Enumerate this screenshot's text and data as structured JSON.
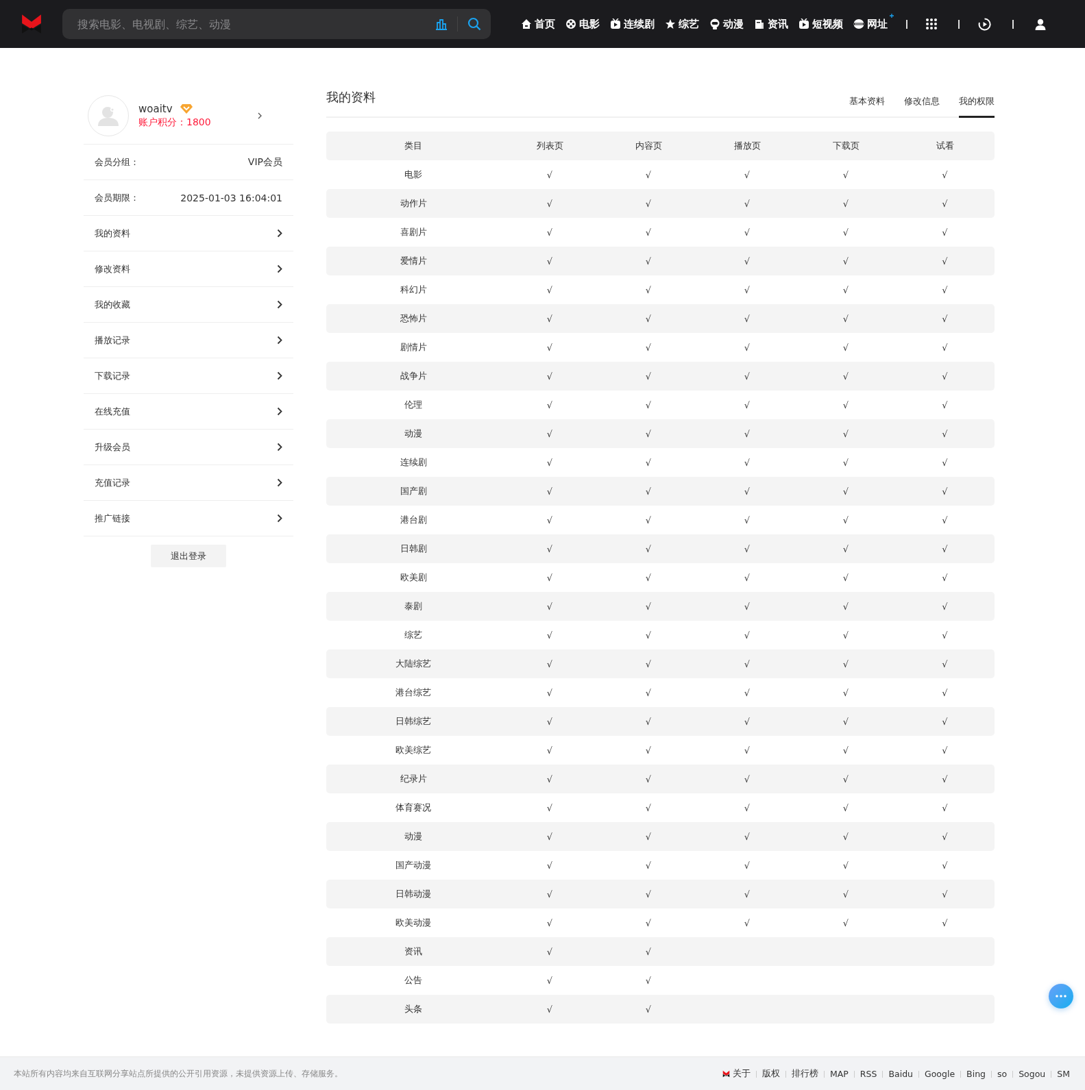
{
  "header": {
    "search": {
      "placeholder": "搜索电影、电视剧、综艺、动漫"
    },
    "nav": [
      {
        "label": "首页",
        "kind": "home"
      },
      {
        "label": "电影",
        "kind": "film"
      },
      {
        "label": "连续剧",
        "kind": "tv"
      },
      {
        "label": "综艺",
        "kind": "star"
      },
      {
        "label": "动漫",
        "kind": "face"
      },
      {
        "label": "资讯",
        "kind": "doc"
      },
      {
        "label": "短视频",
        "kind": "tv"
      },
      {
        "label": "网址",
        "kind": "globe"
      }
    ]
  },
  "sidebar": {
    "user": {
      "name": "woaitv",
      "points": "账户积分：1800"
    },
    "info": [
      {
        "label": "会员分组：",
        "value": "VIP会员"
      },
      {
        "label": "会员期限：",
        "value": "2025-01-03 16:04:01"
      }
    ],
    "menu": [
      "我的资料",
      "修改资料",
      "我的收藏",
      "播放记录",
      "下载记录",
      "在线充值",
      "升级会员",
      "充值记录",
      "推广链接"
    ],
    "logout": "退出登录"
  },
  "main": {
    "title": "我的资料",
    "tabs": [
      {
        "label": "基本资料",
        "selected": false
      },
      {
        "label": "修改信息",
        "selected": false
      },
      {
        "label": "我的权限",
        "selected": true
      }
    ],
    "table": {
      "columns": [
        "类目",
        "列表页",
        "内容页",
        "播放页",
        "下载页",
        "试看"
      ],
      "rows": [
        {
          "cells": [
            "电影",
            "√",
            "√",
            "√",
            "√",
            "√"
          ]
        },
        {
          "cells": [
            "动作片",
            "√",
            "√",
            "√",
            "√",
            "√"
          ]
        },
        {
          "cells": [
            "喜剧片",
            "√",
            "√",
            "√",
            "√",
            "√"
          ]
        },
        {
          "cells": [
            "爱情片",
            "√",
            "√",
            "√",
            "√",
            "√"
          ]
        },
        {
          "cells": [
            "科幻片",
            "√",
            "√",
            "√",
            "√",
            "√"
          ]
        },
        {
          "cells": [
            "恐怖片",
            "√",
            "√",
            "√",
            "√",
            "√"
          ]
        },
        {
          "cells": [
            "剧情片",
            "√",
            "√",
            "√",
            "√",
            "√"
          ]
        },
        {
          "cells": [
            "战争片",
            "√",
            "√",
            "√",
            "√",
            "√"
          ]
        },
        {
          "cells": [
            "伦理",
            "√",
            "√",
            "√",
            "√",
            "√"
          ]
        },
        {
          "cells": [
            "动漫",
            "√",
            "√",
            "√",
            "√",
            "√"
          ]
        },
        {
          "cells": [
            "连续剧",
            "√",
            "√",
            "√",
            "√",
            "√"
          ]
        },
        {
          "cells": [
            "国产剧",
            "√",
            "√",
            "√",
            "√",
            "√"
          ]
        },
        {
          "cells": [
            "港台剧",
            "√",
            "√",
            "√",
            "√",
            "√"
          ]
        },
        {
          "cells": [
            "日韩剧",
            "√",
            "√",
            "√",
            "√",
            "√"
          ]
        },
        {
          "cells": [
            "欧美剧",
            "√",
            "√",
            "√",
            "√",
            "√"
          ]
        },
        {
          "cells": [
            "泰剧",
            "√",
            "√",
            "√",
            "√",
            "√"
          ]
        },
        {
          "cells": [
            "综艺",
            "√",
            "√",
            "√",
            "√",
            "√"
          ]
        },
        {
          "cells": [
            "大陆综艺",
            "√",
            "√",
            "√",
            "√",
            "√"
          ]
        },
        {
          "cells": [
            "港台综艺",
            "√",
            "√",
            "√",
            "√",
            "√"
          ]
        },
        {
          "cells": [
            "日韩综艺",
            "√",
            "√",
            "√",
            "√",
            "√"
          ]
        },
        {
          "cells": [
            "欧美综艺",
            "√",
            "√",
            "√",
            "√",
            "√"
          ]
        },
        {
          "cells": [
            "纪录片",
            "√",
            "√",
            "√",
            "√",
            "√"
          ]
        },
        {
          "cells": [
            "体育赛况",
            "√",
            "√",
            "√",
            "√",
            "√"
          ]
        },
        {
          "cells": [
            "动漫",
            "√",
            "√",
            "√",
            "√",
            "√"
          ]
        },
        {
          "cells": [
            "国产动漫",
            "√",
            "√",
            "√",
            "√",
            "√"
          ]
        },
        {
          "cells": [
            "日韩动漫",
            "√",
            "√",
            "√",
            "√",
            "√"
          ]
        },
        {
          "cells": [
            "欧美动漫",
            "√",
            "√",
            "√",
            "√",
            "√"
          ]
        },
        {
          "cells": [
            "资讯",
            "√",
            "√"
          ]
        },
        {
          "cells": [
            "公告",
            "√",
            "√"
          ]
        },
        {
          "cells": [
            "头条",
            "√",
            "√"
          ]
        }
      ]
    }
  },
  "footer": {
    "notice": "本站所有内容均来自互联网分享站点所提供的公开引用资源，未提供资源上传、存储服务。",
    "links": [
      "关于",
      "版权",
      "排行榜",
      "MAP",
      "RSS",
      "Baidu",
      "Google",
      "Bing",
      "so",
      "Sogou",
      "SM"
    ]
  }
}
